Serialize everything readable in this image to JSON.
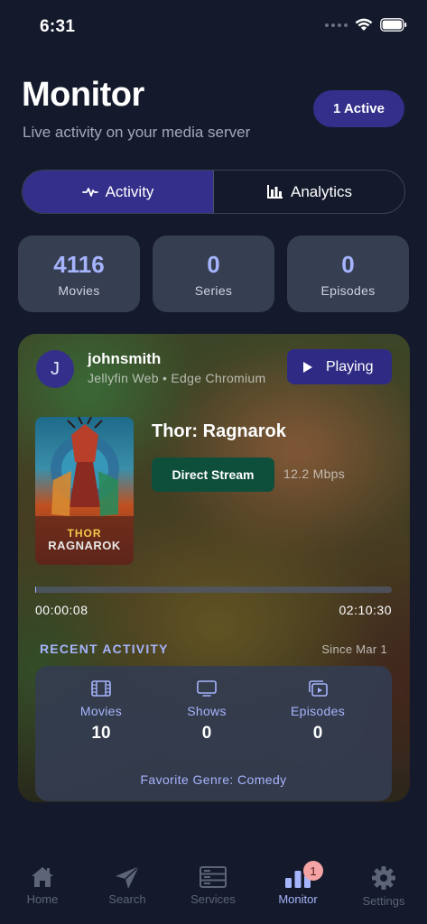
{
  "status_bar": {
    "time": "6:31"
  },
  "header": {
    "title": "Monitor",
    "subtitle": "Live activity on your media server",
    "active_badge": "1 Active"
  },
  "segments": [
    {
      "label": "Activity",
      "icon": "pulse-icon",
      "selected": true
    },
    {
      "label": "Analytics",
      "icon": "bar-chart-icon",
      "selected": false
    }
  ],
  "stats": [
    {
      "value": "4116",
      "label": "Movies"
    },
    {
      "value": "0",
      "label": "Series"
    },
    {
      "value": "0",
      "label": "Episodes"
    }
  ],
  "session": {
    "avatar_initial": "J",
    "username": "johnsmith",
    "client": "Jellyfin Web • Edge Chromium",
    "state_button": "Playing",
    "poster_text_line1": "THOR",
    "poster_text_line2": "RAGNAROK",
    "movie_title": "Thor: Ragnarok",
    "stream_type": "Direct Stream",
    "bitrate": "12.2 Mbps",
    "progress_fraction": 0.001,
    "position": "00:00:08",
    "duration": "02:10:30"
  },
  "recent": {
    "heading": "RECENT ACTIVITY",
    "since": "Since Mar 1",
    "items": [
      {
        "label": "Movies",
        "value": "10",
        "icon": "film-icon"
      },
      {
        "label": "Shows",
        "value": "0",
        "icon": "tv-icon"
      },
      {
        "label": "Episodes",
        "value": "0",
        "icon": "episodes-icon"
      }
    ],
    "favorite_genre": "Favorite Genre: Comedy"
  },
  "tabs": [
    {
      "label": "Home",
      "icon": "home-icon"
    },
    {
      "label": "Search",
      "icon": "search-icon"
    },
    {
      "label": "Services",
      "icon": "server-icon"
    },
    {
      "label": "Monitor",
      "icon": "bar-chart-icon",
      "badge": "1",
      "selected": true
    },
    {
      "label": "Settings",
      "icon": "gear-icon"
    }
  ],
  "colors": {
    "background": "#141a2b",
    "accent": "#a5b4fc",
    "primary": "#332f8a",
    "card": "#363e52",
    "stream_badge": "#0e4f3c",
    "tab_badge": "#f3a3a3"
  }
}
